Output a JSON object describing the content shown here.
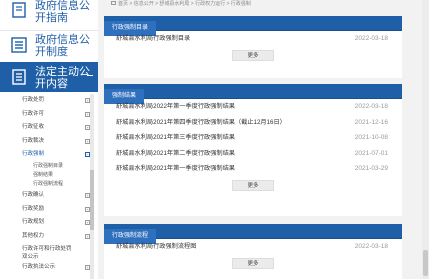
{
  "sidebar": {
    "guide_label": "政府信息公开指南",
    "system_label": "政府信息公开制度",
    "active_label": "法定主动公开内容",
    "items": [
      {
        "label": "行政处罚",
        "toggle": "+"
      },
      {
        "label": "行政许可",
        "toggle": "+"
      },
      {
        "label": "行政征收",
        "toggle": "+"
      },
      {
        "label": "行政裁决",
        "toggle": "+"
      },
      {
        "label": "行政强制",
        "toggle": "−"
      }
    ],
    "subitems": [
      "行政强制目录",
      "强制结果",
      "行政强制流程"
    ],
    "items_after": [
      {
        "label": "行政确认",
        "toggle": "+"
      },
      {
        "label": "行政奖励",
        "toggle": "+"
      },
      {
        "label": "行政规划",
        "toggle": "+"
      },
      {
        "label": "其他权力",
        "toggle": "+"
      },
      {
        "label": "行政许可和行政处罚双公示",
        "toggle": ""
      },
      {
        "label": "行政执法公示",
        "toggle": "+"
      }
    ]
  },
  "breadcrumb": "首页 > 信息公开 > 舒城县水利局 > 行政权力运行 > 行政强制",
  "panels": {
    "directory": {
      "tab": "行政强制目录",
      "rows": [
        {
          "title": "舒城县水利局行政强制目录",
          "date": "2022-03-18"
        }
      ],
      "more": "更多"
    },
    "results": {
      "tab": "强制结果",
      "rows": [
        {
          "title": "舒城县水利局2022年第一季度行政强制结果",
          "date": "2022-03-18"
        },
        {
          "title": "舒城县水利局2021年第四季度行政强制结果（截止12月16日）",
          "date": "2021-12-16"
        },
        {
          "title": "舒城县水利局2021年第三季度行政强制结果",
          "date": "2021-10-08"
        },
        {
          "title": "舒城县水利局2021年第二季度行政强制结果",
          "date": "2021-07-01"
        },
        {
          "title": "舒城县水利局2021年第一季度行政强制结果",
          "date": "2021-03-29"
        }
      ],
      "more": "更多"
    },
    "process": {
      "tab": "行政强制流程",
      "rows": [
        {
          "title": "舒城县水利局行政强制流程图",
          "date": "2022-03-18"
        }
      ],
      "more": "更多"
    }
  },
  "colors": {
    "brand": "#1f5fa8",
    "tab": "#2e70bd",
    "page_bg": "#f2f2f2"
  }
}
